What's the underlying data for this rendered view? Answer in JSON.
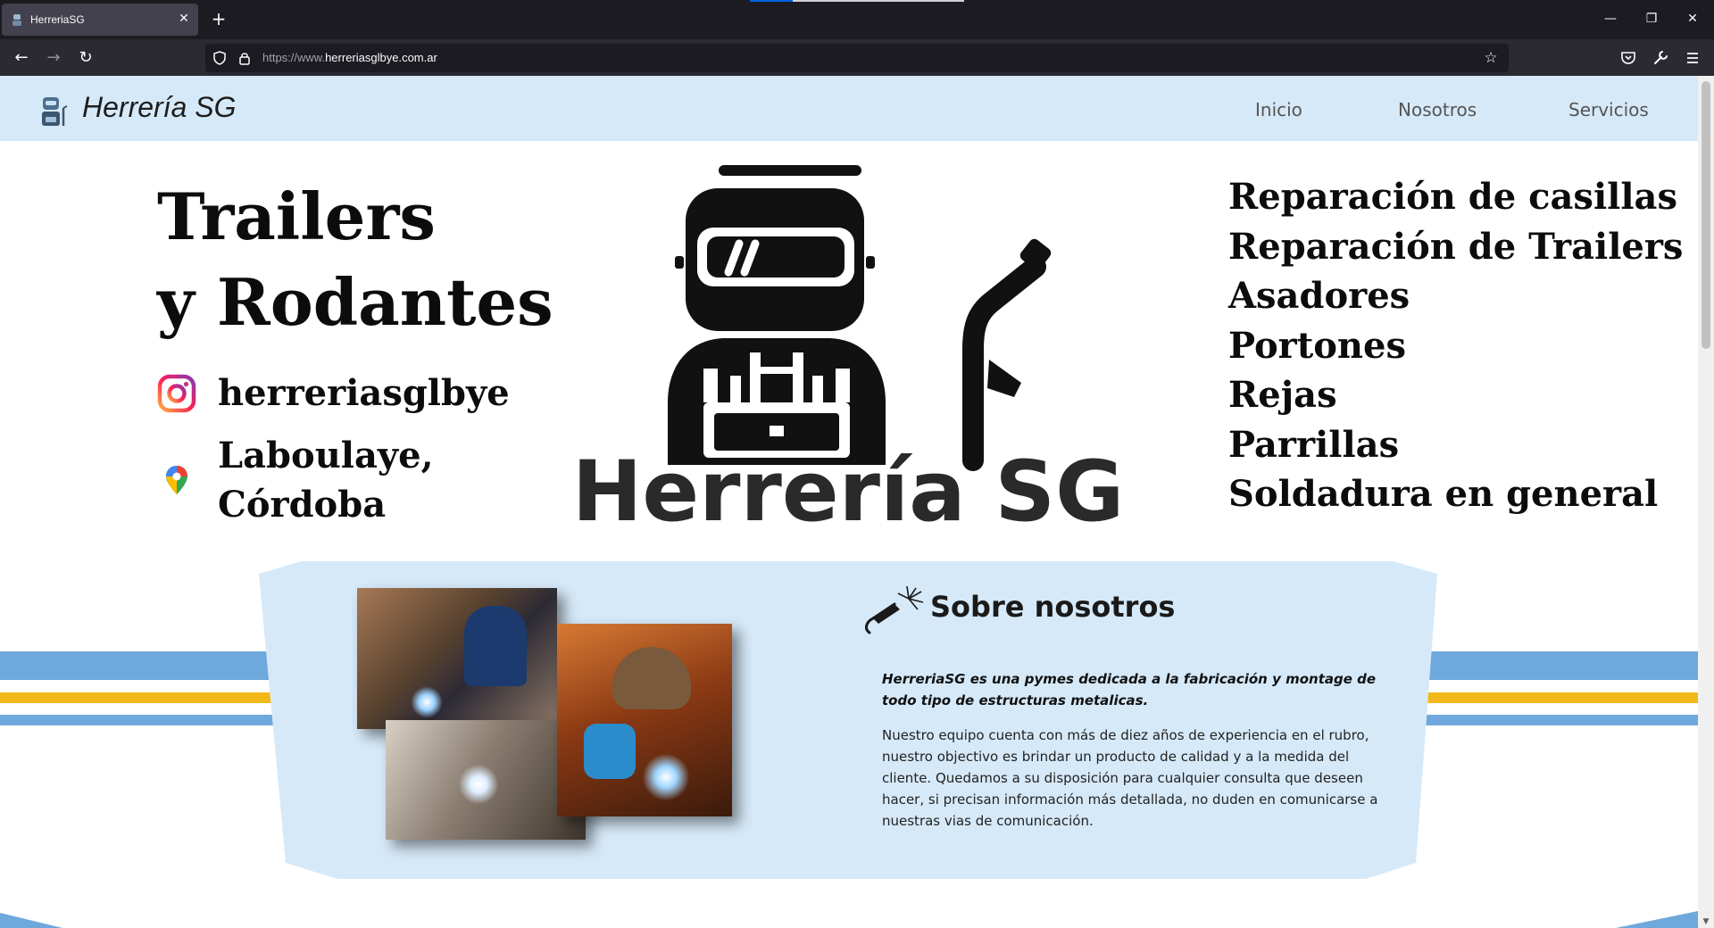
{
  "browser": {
    "tab_title": "HerreriaSG",
    "url_protocol": "https://www.",
    "url_host": "herreriasglbye.com.ar"
  },
  "site": {
    "brand": "Herrería SG",
    "nav": [
      "Inicio",
      "Nosotros",
      "Servicios"
    ]
  },
  "hero": {
    "title_line1": "Trailers",
    "title_line2": "y Rodantes",
    "instagram_handle": "herreriasglbye",
    "location_line1": "Laboulaye,",
    "location_line2": "Córdoba",
    "logo_text": "Herrería SG",
    "services": [
      "Reparación de casillas",
      "Reparación de Trailers",
      "Asadores",
      "Portones",
      "Rejas",
      "Parrillas",
      "Soldadura en general"
    ]
  },
  "about": {
    "title": "Sobre nosotros",
    "lead": "HerreriaSG es una pymes dedicada a la fabricación y montage de todo tipo de estructuras metalicas.",
    "body": "Nuestro equipo cuenta con más de diez años de experiencia en el rubro, nuestro objectivo es brindar un producto de calidad y a la medida del cliente. Quedamos a su disposición para cualquier consulta que deseen hacer, si precisan información más detallada, no duden en comunicarse a nuestras vias de comunicación."
  },
  "colors": {
    "header_bg": "#d6e9f8",
    "stripe_blue": "#6ea8dc",
    "stripe_yellow": "#f2b81a",
    "panel_bg": "#d6e9f8"
  }
}
